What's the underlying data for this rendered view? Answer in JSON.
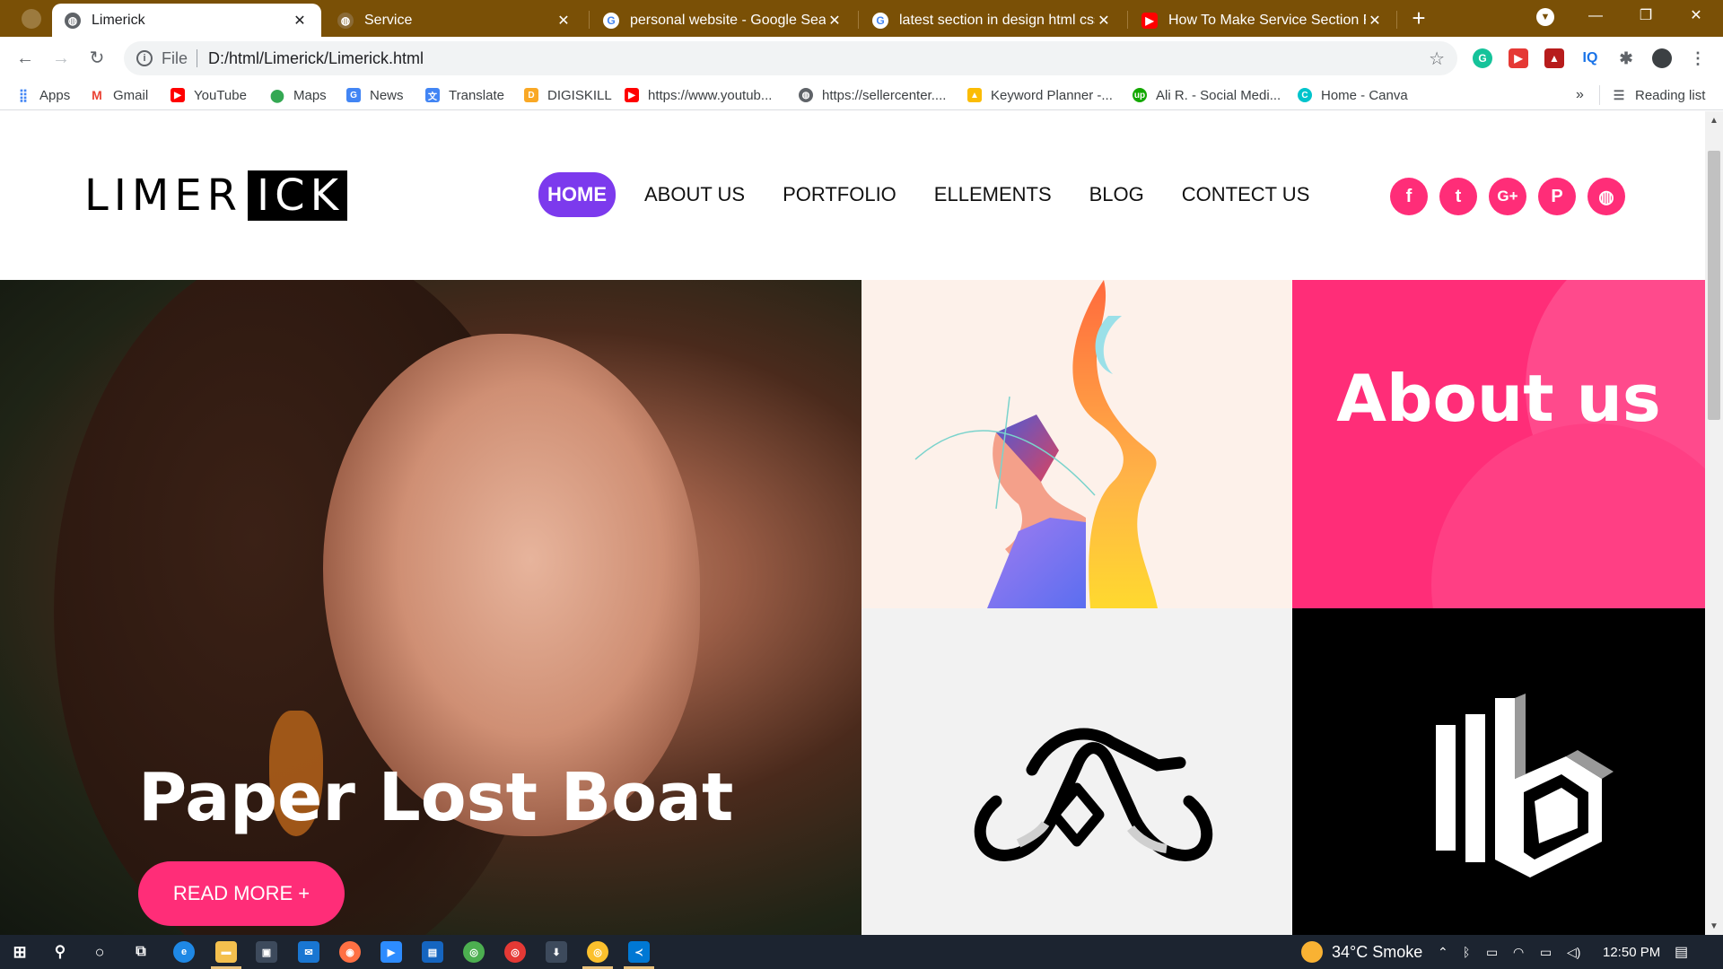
{
  "browser": {
    "tabs": [
      {
        "title": "Limerick",
        "active": true,
        "icon": "globe-icon"
      },
      {
        "title": "Service",
        "active": false,
        "icon": "globe-icon"
      },
      {
        "title": "personal website - Google Search",
        "active": false,
        "icon": "google-icon"
      },
      {
        "title": "latest section in design html css",
        "active": false,
        "icon": "google-icon"
      },
      {
        "title": "How To Make Service Section For",
        "active": false,
        "icon": "youtube-icon"
      }
    ],
    "address": {
      "scheme": "File",
      "url": "D:/html/Limerick/Limerick.html"
    },
    "bookmarks": [
      {
        "label": "Apps",
        "icon": "apps-grid-icon"
      },
      {
        "label": "Gmail",
        "icon": "gmail-icon"
      },
      {
        "label": "YouTube",
        "icon": "youtube-icon"
      },
      {
        "label": "Maps",
        "icon": "maps-pin-icon"
      },
      {
        "label": "News",
        "icon": "news-icon"
      },
      {
        "label": "Translate",
        "icon": "translate-icon"
      },
      {
        "label": "DIGISKILL",
        "icon": "digiskill-icon"
      },
      {
        "label": "https://www.youtub...",
        "icon": "youtube-icon"
      },
      {
        "label": "https://sellercenter....",
        "icon": "globe-icon"
      },
      {
        "label": "Keyword Planner -...",
        "icon": "google-ads-icon"
      },
      {
        "label": "Ali R. - Social Medi...",
        "icon": "upwork-icon"
      },
      {
        "label": "Home - Canva",
        "icon": "canva-icon"
      }
    ],
    "bookmarks_overflow": "»",
    "reading_list": "Reading list"
  },
  "site": {
    "logo_part1": "LIMER",
    "logo_part2": "ICK",
    "menu": [
      {
        "label": "HOME",
        "active": true
      },
      {
        "label": "ABOUT US",
        "active": false
      },
      {
        "label": "PORTFOLIO",
        "active": false
      },
      {
        "label": "ELLEMENTS",
        "active": false
      },
      {
        "label": "BLOG",
        "active": false
      },
      {
        "label": "CONTECT US",
        "active": false
      }
    ],
    "social": [
      {
        "icon": "facebook-icon",
        "glyph": "f"
      },
      {
        "icon": "twitter-icon",
        "glyph": "t"
      },
      {
        "icon": "google-plus-icon",
        "glyph": "G+"
      },
      {
        "icon": "pinterest-icon",
        "glyph": "P"
      },
      {
        "icon": "globe-icon",
        "glyph": "◍"
      }
    ],
    "hero": {
      "title": "Paper Lost Boat",
      "button": "READ MORE +"
    },
    "about_tile": {
      "title": "About us"
    }
  },
  "taskbar": {
    "weather": "34°C  Smoke",
    "time": "12:50 PM"
  },
  "colors": {
    "accent_pink": "#ff2d78",
    "accent_purple": "#7c3aed",
    "tabstrip": "#7a5006"
  }
}
